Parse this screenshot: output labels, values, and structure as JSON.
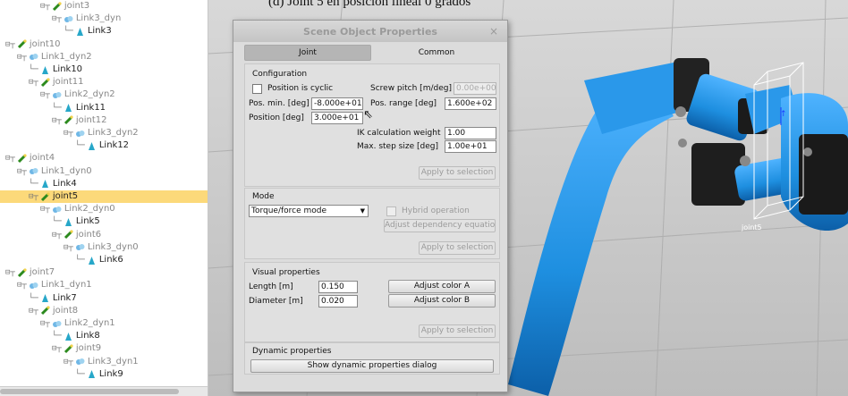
{
  "caption": "(d) Joint 5 en posición lineal 0 grados",
  "hierarchy": [
    {
      "label": "joint3",
      "type": "joint",
      "level": 3,
      "dim": true
    },
    {
      "label": "Link3_dyn",
      "type": "dyn",
      "level": 4,
      "dim": true
    },
    {
      "label": "Link3",
      "type": "link",
      "level": 5,
      "dim": false
    },
    {
      "label": "joint10",
      "type": "joint",
      "level": 0,
      "dim": true
    },
    {
      "label": "Link1_dyn2",
      "type": "dyn",
      "level": 1,
      "dim": true
    },
    {
      "label": "Link10",
      "type": "link",
      "level": 2,
      "dim": false
    },
    {
      "label": "joint11",
      "type": "joint",
      "level": 2,
      "dim": true
    },
    {
      "label": "Link2_dyn2",
      "type": "dyn",
      "level": 3,
      "dim": true
    },
    {
      "label": "Link11",
      "type": "link",
      "level": 4,
      "dim": false
    },
    {
      "label": "joint12",
      "type": "joint",
      "level": 4,
      "dim": true
    },
    {
      "label": "Link3_dyn2",
      "type": "dyn",
      "level": 5,
      "dim": true
    },
    {
      "label": "Link12",
      "type": "link",
      "level": 6,
      "dim": false
    },
    {
      "label": "joint4",
      "type": "joint",
      "level": 0,
      "dim": true
    },
    {
      "label": "Link1_dyn0",
      "type": "dyn",
      "level": 1,
      "dim": true
    },
    {
      "label": "Link4",
      "type": "link",
      "level": 2,
      "dim": false
    },
    {
      "label": "joint5",
      "type": "joint",
      "level": 2,
      "dim": false,
      "selected": true
    },
    {
      "label": "Link2_dyn0",
      "type": "dyn",
      "level": 3,
      "dim": true
    },
    {
      "label": "Link5",
      "type": "link",
      "level": 4,
      "dim": false
    },
    {
      "label": "joint6",
      "type": "joint",
      "level": 4,
      "dim": true
    },
    {
      "label": "Link3_dyn0",
      "type": "dyn",
      "level": 5,
      "dim": true
    },
    {
      "label": "Link6",
      "type": "link",
      "level": 6,
      "dim": false
    },
    {
      "label": "joint7",
      "type": "joint",
      "level": 0,
      "dim": true
    },
    {
      "label": "Link1_dyn1",
      "type": "dyn",
      "level": 1,
      "dim": true
    },
    {
      "label": "Link7",
      "type": "link",
      "level": 2,
      "dim": false
    },
    {
      "label": "joint8",
      "type": "joint",
      "level": 2,
      "dim": true
    },
    {
      "label": "Link2_dyn1",
      "type": "dyn",
      "level": 3,
      "dim": true
    },
    {
      "label": "Link8",
      "type": "link",
      "level": 4,
      "dim": false
    },
    {
      "label": "joint9",
      "type": "joint",
      "level": 4,
      "dim": true
    },
    {
      "label": "Link3_dyn1",
      "type": "dyn",
      "level": 5,
      "dim": true
    },
    {
      "label": "Link9",
      "type": "link",
      "level": 6,
      "dim": false
    }
  ],
  "scene": {
    "joint_label": "joint5"
  },
  "dialog": {
    "title": "Scene Object Properties",
    "close": "×",
    "tabs": {
      "joint": "Joint",
      "common": "Common"
    },
    "configuration": {
      "heading": "Configuration",
      "cyclic_label": "Position is cyclic",
      "screw_label": "Screw pitch [m/deg]",
      "screw_value": "0.00e+00",
      "pos_min_label": "Pos. min. [deg]",
      "pos_min_value": "-8.000e+01",
      "pos_range_label": "Pos. range [deg]",
      "pos_range_value": "1.600e+02",
      "position_label": "Position [deg]",
      "position_value": "3.000e+01",
      "ik_label": "IK calculation weight",
      "ik_value": "1.00",
      "max_step_label": "Max. step size [deg]",
      "max_step_value": "1.00e+01",
      "apply": "Apply to selection"
    },
    "mode": {
      "heading": "Mode",
      "selected": "Torque/force mode",
      "hybrid_label": "Hybrid operation",
      "adjust_dep": "Adjust dependency equation",
      "apply": "Apply to selection"
    },
    "visual": {
      "heading": "Visual properties",
      "length_label": "Length [m]",
      "length_value": "0.150",
      "diameter_label": "Diameter [m]",
      "diameter_value": "0.020",
      "color_a": "Adjust color A",
      "color_b": "Adjust color B",
      "apply": "Apply to selection"
    },
    "dynamic": {
      "heading": "Dynamic properties",
      "button": "Show dynamic properties dialog"
    }
  },
  "colors": {
    "robot": "#1e8fe0",
    "selection": "#fcd97a",
    "floor": "#c9c9c9"
  }
}
